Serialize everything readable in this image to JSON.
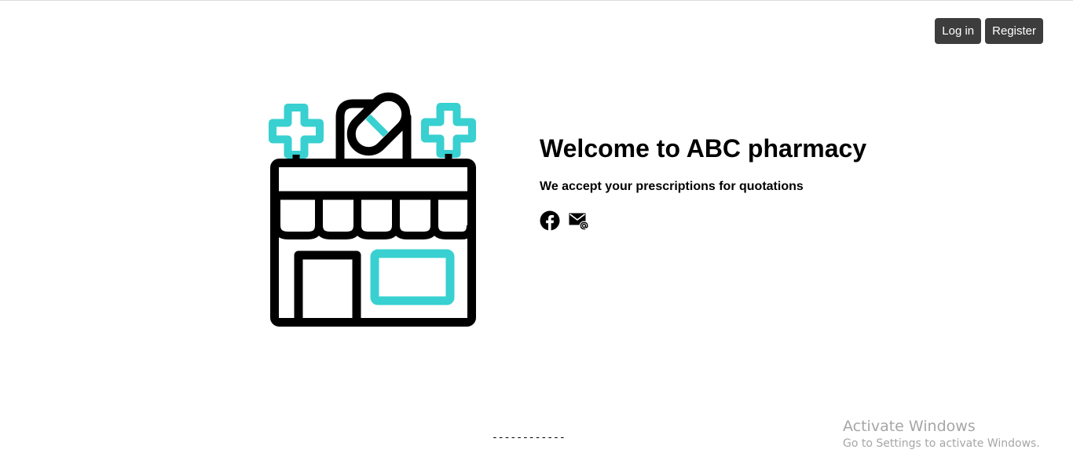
{
  "header": {
    "login_label": "Log in",
    "register_label": "Register"
  },
  "hero": {
    "title": "Welcome to ABC pharmacy",
    "subtitle": "We accept your prescriptions for quotations"
  },
  "icons": {
    "store": "pharmacy-store-icon",
    "facebook": "facebook-icon",
    "email": "email-icon"
  },
  "colors": {
    "accent": "#38d0d0",
    "button_bg": "#3d3d3d",
    "button_text": "#ffffff",
    "watermark": "#a6a6a6"
  },
  "footer": {
    "separator": "------------"
  },
  "watermark": {
    "title": "Activate Windows",
    "subtitle": "Go to Settings to activate Windows."
  }
}
